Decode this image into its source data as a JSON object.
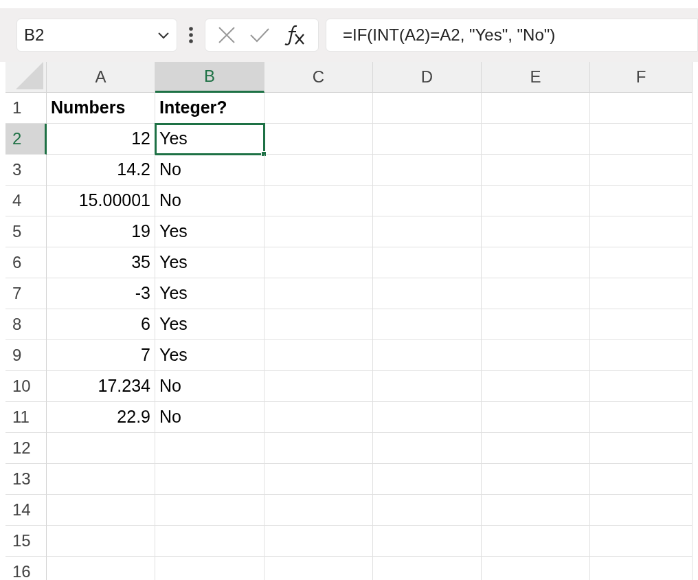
{
  "name_box": "B2",
  "formula": "=IF(INT(A2)=A2, \"Yes\", \"No\")",
  "columns": [
    {
      "label": "A",
      "selected": false
    },
    {
      "label": "B",
      "selected": true
    },
    {
      "label": "C",
      "selected": false
    },
    {
      "label": "D",
      "selected": false
    },
    {
      "label": "E",
      "selected": false
    },
    {
      "label": "F",
      "selected": false
    }
  ],
  "rows": [
    {
      "label": "1",
      "selected": false,
      "cells": [
        {
          "text": "Numbers",
          "kind": "header",
          "selected": false
        },
        {
          "text": "Integer?",
          "kind": "header",
          "selected": false
        }
      ]
    },
    {
      "label": "2",
      "selected": true,
      "cells": [
        {
          "text": "12",
          "kind": "number",
          "selected": false
        },
        {
          "text": "Yes",
          "kind": "text",
          "selected": true
        }
      ]
    },
    {
      "label": "3",
      "selected": false,
      "cells": [
        {
          "text": "14.2",
          "kind": "number",
          "selected": false
        },
        {
          "text": "No",
          "kind": "text",
          "selected": false
        }
      ]
    },
    {
      "label": "4",
      "selected": false,
      "cells": [
        {
          "text": "15.00001",
          "kind": "number",
          "selected": false
        },
        {
          "text": "No",
          "kind": "text",
          "selected": false
        }
      ]
    },
    {
      "label": "5",
      "selected": false,
      "cells": [
        {
          "text": "19",
          "kind": "number",
          "selected": false
        },
        {
          "text": "Yes",
          "kind": "text",
          "selected": false
        }
      ]
    },
    {
      "label": "6",
      "selected": false,
      "cells": [
        {
          "text": "35",
          "kind": "number",
          "selected": false
        },
        {
          "text": "Yes",
          "kind": "text",
          "selected": false
        }
      ]
    },
    {
      "label": "7",
      "selected": false,
      "cells": [
        {
          "text": "-3",
          "kind": "number",
          "selected": false
        },
        {
          "text": "Yes",
          "kind": "text",
          "selected": false
        }
      ]
    },
    {
      "label": "8",
      "selected": false,
      "cells": [
        {
          "text": "6",
          "kind": "number",
          "selected": false
        },
        {
          "text": "Yes",
          "kind": "text",
          "selected": false
        }
      ]
    },
    {
      "label": "9",
      "selected": false,
      "cells": [
        {
          "text": "7",
          "kind": "number",
          "selected": false
        },
        {
          "text": "Yes",
          "kind": "text",
          "selected": false
        }
      ]
    },
    {
      "label": "10",
      "selected": false,
      "cells": [
        {
          "text": "17.234",
          "kind": "number",
          "selected": false
        },
        {
          "text": "No",
          "kind": "text",
          "selected": false
        }
      ]
    },
    {
      "label": "11",
      "selected": false,
      "cells": [
        {
          "text": "22.9",
          "kind": "number",
          "selected": false
        },
        {
          "text": "No",
          "kind": "text",
          "selected": false
        }
      ]
    },
    {
      "label": "12",
      "selected": false,
      "cells": []
    },
    {
      "label": "13",
      "selected": false,
      "cells": []
    },
    {
      "label": "14",
      "selected": false,
      "cells": []
    },
    {
      "label": "15",
      "selected": false,
      "cells": []
    },
    {
      "label": "16",
      "selected": false,
      "cells": []
    }
  ]
}
